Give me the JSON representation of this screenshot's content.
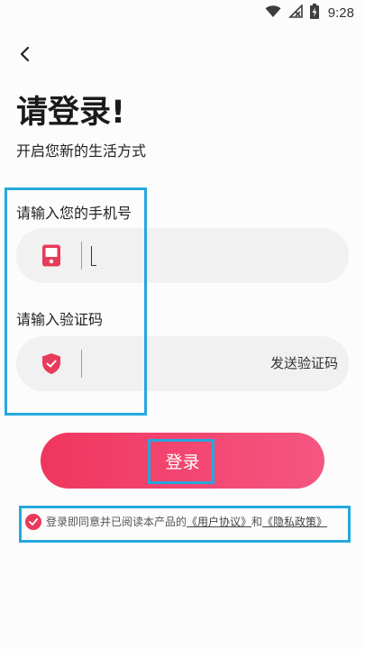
{
  "status_bar": {
    "time": "9:28",
    "icons": [
      "wifi-icon",
      "signal-off-icon",
      "battery-charging-icon"
    ]
  },
  "header": {
    "back_icon": "chevron-left-icon"
  },
  "title": "请登录!",
  "subtitle": "开启您新的生活方式",
  "phone_field": {
    "label": "请输入您的手机号",
    "icon": "phone-icon",
    "value": ""
  },
  "code_field": {
    "label": "请输入验证码",
    "icon": "shield-check-icon",
    "value": "",
    "send_code_label": "发送验证码"
  },
  "login_button": {
    "label": "登录"
  },
  "agreement": {
    "checked": true,
    "prefix": "登录即同意并已阅读本产品的",
    "user_agreement": "《用户协议》",
    "conjunction": "和",
    "privacy_policy": "《隐私政策》"
  },
  "colors": {
    "accent": "#f0365e",
    "accent_end": "#f45682",
    "icon_red": "#e83a5a",
    "input_bg": "#f1f1f1",
    "highlight": "#24a8de"
  }
}
